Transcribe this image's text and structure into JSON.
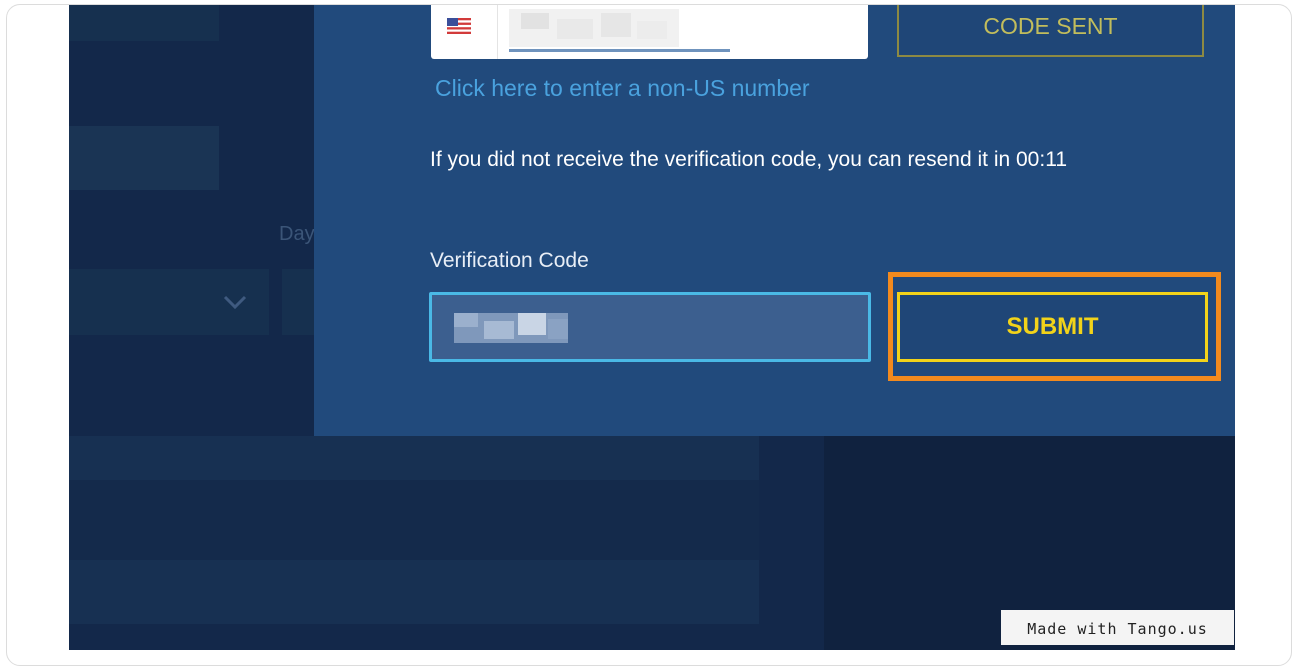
{
  "colors": {
    "page_background": "#13284a",
    "modal_background": "#214a7c",
    "link": "#4aa2de",
    "submit_accent": "#f2d31a",
    "highlight": "#f28a1e",
    "code_sent_accent": "#c2bd5c",
    "input_focus_border": "#4ab9e6"
  },
  "background": {
    "partial_label": "Day"
  },
  "modal": {
    "flag_icon": "us-flag-icon",
    "code_sent_label": "CODE SENT",
    "non_us_link": "Click here to enter a non-US number",
    "resend_message": "If you did not receive the verification code, you can resend it in 00:11",
    "verification_label": "Verification Code",
    "submit_label": "SUBMIT"
  },
  "watermark": {
    "text": "Made with Tango.us"
  }
}
